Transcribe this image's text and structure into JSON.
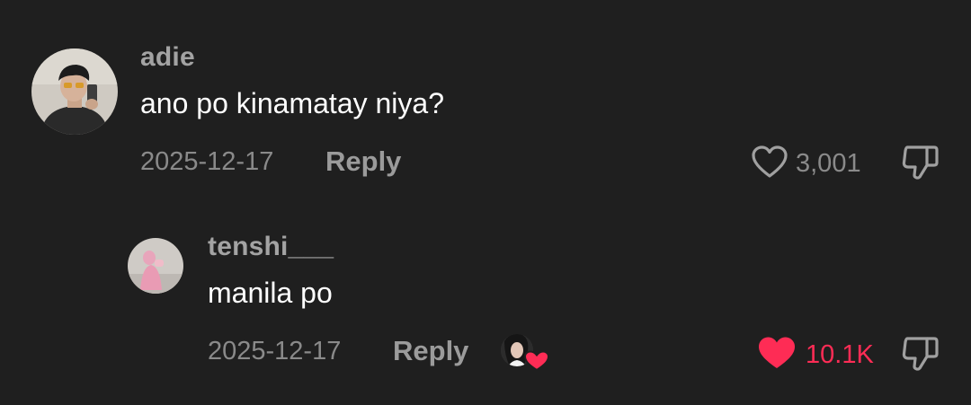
{
  "comments": [
    {
      "username": "adie",
      "text": "ano po kinamatay niya?",
      "date": "2025-12-17",
      "reply_label": "Reply",
      "like_count": "3,001",
      "liked": false,
      "avatar_icon": "user-avatar",
      "like_icon": "heart-outline-icon",
      "dislike_icon": "thumbs-down-icon"
    },
    {
      "username": "tenshi___",
      "text": "manila po",
      "date": "2025-12-17",
      "reply_label": "Reply",
      "like_count": "10.1K",
      "liked": true,
      "liked_by_creator": true,
      "avatar_icon": "user-avatar",
      "like_icon": "heart-filled-icon",
      "dislike_icon": "thumbs-down-icon",
      "creator_like_icon": "creator-liked-icon"
    }
  ],
  "colors": {
    "background": "#1f1f1f",
    "username": "#a3a3a3",
    "text": "#ffffff",
    "meta": "#8a8a8a",
    "liked": "#fe2c55"
  }
}
